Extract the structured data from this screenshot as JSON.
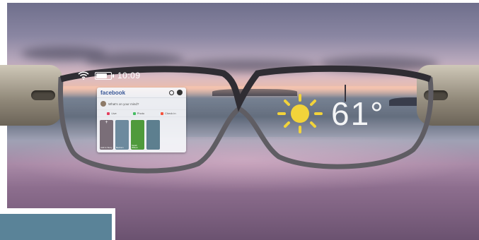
{
  "status_bar": {
    "time": "10:09",
    "battery_level": 0.85,
    "wifi_icon": "wifi-icon"
  },
  "facebook": {
    "logo": "facebook",
    "composer_placeholder": "What's on your mind?",
    "actions": [
      {
        "label": "Live",
        "color": "#e4405f"
      },
      {
        "label": "Photo",
        "color": "#45bd62"
      },
      {
        "label": "Check in",
        "color": "#f5533d"
      }
    ],
    "stories": [
      {
        "caption": "Add to Story",
        "color": "#7a6e78"
      },
      {
        "caption": "Bertram",
        "color": "#6d8a9e"
      },
      {
        "caption": "Sarah Wilson",
        "color": "#4f9a3c"
      },
      {
        "caption": "",
        "color": "#5d7f8f"
      }
    ]
  },
  "weather": {
    "icon": "sun-icon",
    "temperature": "61°",
    "sun_color": "#f2d33a"
  }
}
